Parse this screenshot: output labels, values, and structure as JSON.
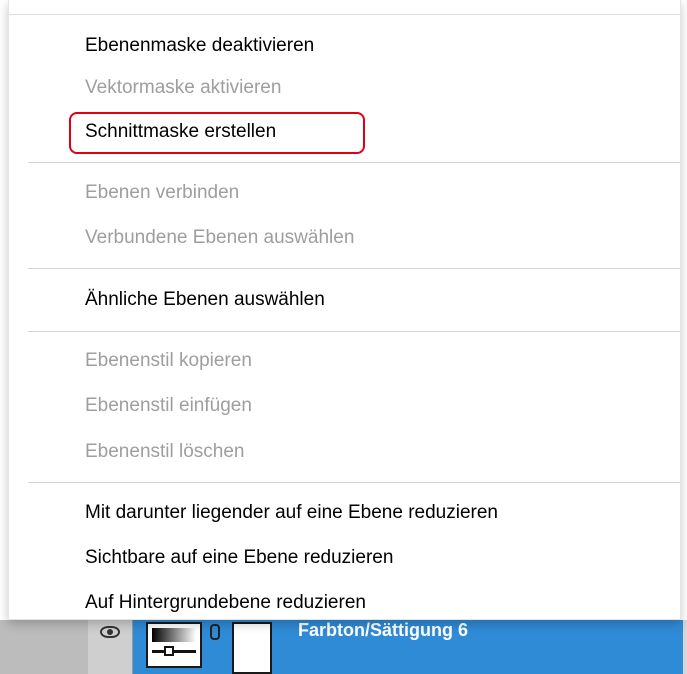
{
  "menu": {
    "groups": [
      {
        "items": [
          {
            "label": "Ebenenmaske deaktivieren",
            "enabled": true
          },
          {
            "label": "Vektormaske aktivieren",
            "enabled": false
          },
          {
            "label": "Schnittmaske erstellen",
            "enabled": true,
            "highlighted": true
          }
        ]
      },
      {
        "items": [
          {
            "label": "Ebenen verbinden",
            "enabled": false
          },
          {
            "label": "Verbundene Ebenen auswählen",
            "enabled": false
          }
        ]
      },
      {
        "items": [
          {
            "label": "Ähnliche Ebenen auswählen",
            "enabled": true
          }
        ]
      },
      {
        "items": [
          {
            "label": "Ebenenstil kopieren",
            "enabled": false
          },
          {
            "label": "Ebenenstil einfügen",
            "enabled": false
          },
          {
            "label": "Ebenenstil löschen",
            "enabled": false
          }
        ]
      },
      {
        "items": [
          {
            "label": "Mit darunter liegender auf eine Ebene reduzieren",
            "enabled": true
          },
          {
            "label": "Sichtbare auf eine Ebene reduzieren",
            "enabled": true
          },
          {
            "label": "Auf Hintergrundebene reduzieren",
            "enabled": true
          }
        ]
      }
    ]
  },
  "layers_panel": {
    "selected_layer_name": "Farbton/Sättigung 6",
    "icons": [
      "eye-icon",
      "adjustment-layer-icon",
      "link-icon",
      "layer-mask-thumbnail"
    ]
  },
  "colors": {
    "highlight_outline": "#e00014",
    "selected_layer": "#2f8bd6",
    "disabled_text": "#9e9e9e"
  }
}
